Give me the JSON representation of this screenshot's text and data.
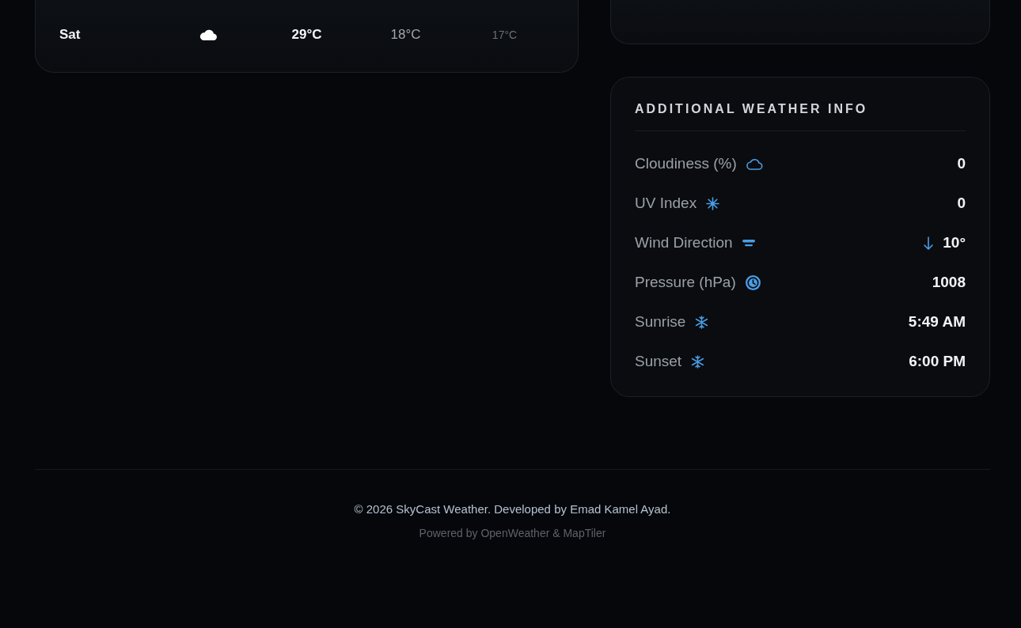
{
  "forecast": {
    "rows": [
      {
        "day": "Sat",
        "column_3": "29°C",
        "column_4": "18°C",
        "column_5": "17°C"
      }
    ]
  },
  "additional_info": {
    "title": "ADDITIONAL WEATHER INFO",
    "rows": [
      {
        "kind": "cloudiness",
        "label": "Cloudiness (%)",
        "value": "0"
      },
      {
        "kind": "uv",
        "label": "UV Index",
        "value": "0"
      },
      {
        "kind": "wind",
        "label": "Wind Direction",
        "value": "10°"
      },
      {
        "kind": "pressure",
        "label": "Pressure (hPa)",
        "value": "1008"
      },
      {
        "kind": "sunrise",
        "label": "Sunrise",
        "value": "5:49 AM"
      },
      {
        "kind": "sunset",
        "label": "Sunset",
        "value": "6:00 PM"
      }
    ]
  },
  "footer": {
    "copyright": "© 2026 SkyCast Weather. Developed by Emad Kamel Ayad.",
    "credits": "Powered by OpenWeather & MapTiler"
  }
}
